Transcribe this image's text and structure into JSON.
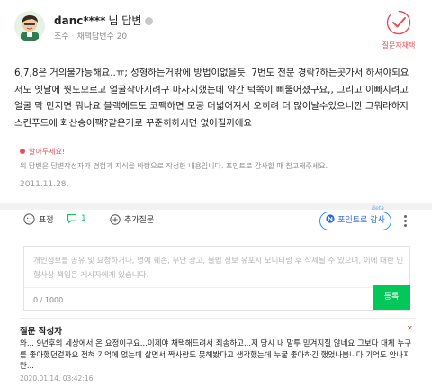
{
  "author": {
    "name": "danc****",
    "name_suffix": "님 답변",
    "rank": "조수",
    "adopt_count": "채택답변수 20"
  },
  "badge": {
    "label": "질문자채택"
  },
  "answer": {
    "text": "6,7,8은 거의불가능해요..ㅠ; 성형하는거밖에 방법이없을듯. 7번도 전문 경락?하는곳가서 하셔야되요 저도 옛날에 뭣도모르고 얼굴작아지려구 마사지했는데 약간 턱쪽이 삐뚤어졌구요,, 그리고 이빠지려고 얼굴 막 만지면 뭐나요 블랙헤드도 코팩하면 모공 더넓어져서 오히려 더 많이날수있으니깐 그뭐라하지 스킨푸드에 화산송이팩?같은거로 꾸준히하시면 없어질꺼에요",
    "notice_title": "알아두세요!",
    "notice_body": "위 답변은 답변작성자가 경험과 지식을 바탕으로 작성한 내용입니다. 포인트로 감사할 때 참고해주세요.",
    "date": "2011.11.28."
  },
  "actions": {
    "emotion_label": "표정",
    "comment_count": "1",
    "add_question_label": "추가질문",
    "point_thanks_label": "포인트로 감사",
    "beta_label": "Beta"
  },
  "comment_input": {
    "placeholder": "개인정보를 공유 및 요청하거나, 명예 훼손, 무단 광고, 불법 정보 유포시 모니터링 후 삭제될 수 있으며, 이에 대한 민형사상 책임은 게시자에게 있습니다.",
    "char_count": "0 / 1000",
    "submit_label": "등록"
  },
  "reply": {
    "title": "질문 작성자",
    "close": "✕",
    "body": "와... 9년후의 세상에서 온 요정이구요...이제야 채택해드려서 죄송하고...저 당시 내 말투 믿겨지질 않네요 그보다 대체 누구를 좋아했던걸까요 전혀 기억에 없는데 살면서 짝사랑도 못해봤다고 생각했는데 누굴 좋아하긴 했었나봅니다 기억도 안나지만...",
    "date": "2020.01.14. 03:42:16"
  },
  "colors": {
    "accent_green": "#03c75a",
    "badge_red": "#e44d5a",
    "point_blue": "#2a8cff"
  },
  "icons": [
    "avatar-character",
    "adopted-check-badge",
    "emotion-smile-icon",
    "comment-icon",
    "add-question-plus-icon",
    "more-vertical-icon"
  ]
}
